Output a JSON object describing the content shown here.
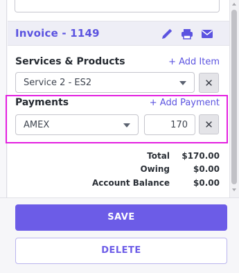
{
  "invoice": {
    "title": "Invoice - 1149"
  },
  "icons": {
    "edit": "pencil-icon",
    "print": "printer-icon",
    "email": "envelope-icon",
    "remove": "close-icon",
    "dropdown": "caret-down-icon"
  },
  "services": {
    "label": "Services & Products",
    "add_label": "+ Add Item",
    "selected": "Service 2 - ES2",
    "remove_label": "✕"
  },
  "payments": {
    "label": "Payments",
    "add_label": "+ Add Payment",
    "method": "AMEX",
    "amount": "170",
    "remove_label": "✕"
  },
  "totals": [
    {
      "label": "Total",
      "value": "$170.00"
    },
    {
      "label": "Owing",
      "value": "$0.00"
    },
    {
      "label": "Account Balance",
      "value": "$0.00"
    }
  ],
  "actions": {
    "save": "SAVE",
    "delete": "DELETE"
  },
  "colors": {
    "accent": "#6c5ce7",
    "highlight": "#e31ee0"
  }
}
